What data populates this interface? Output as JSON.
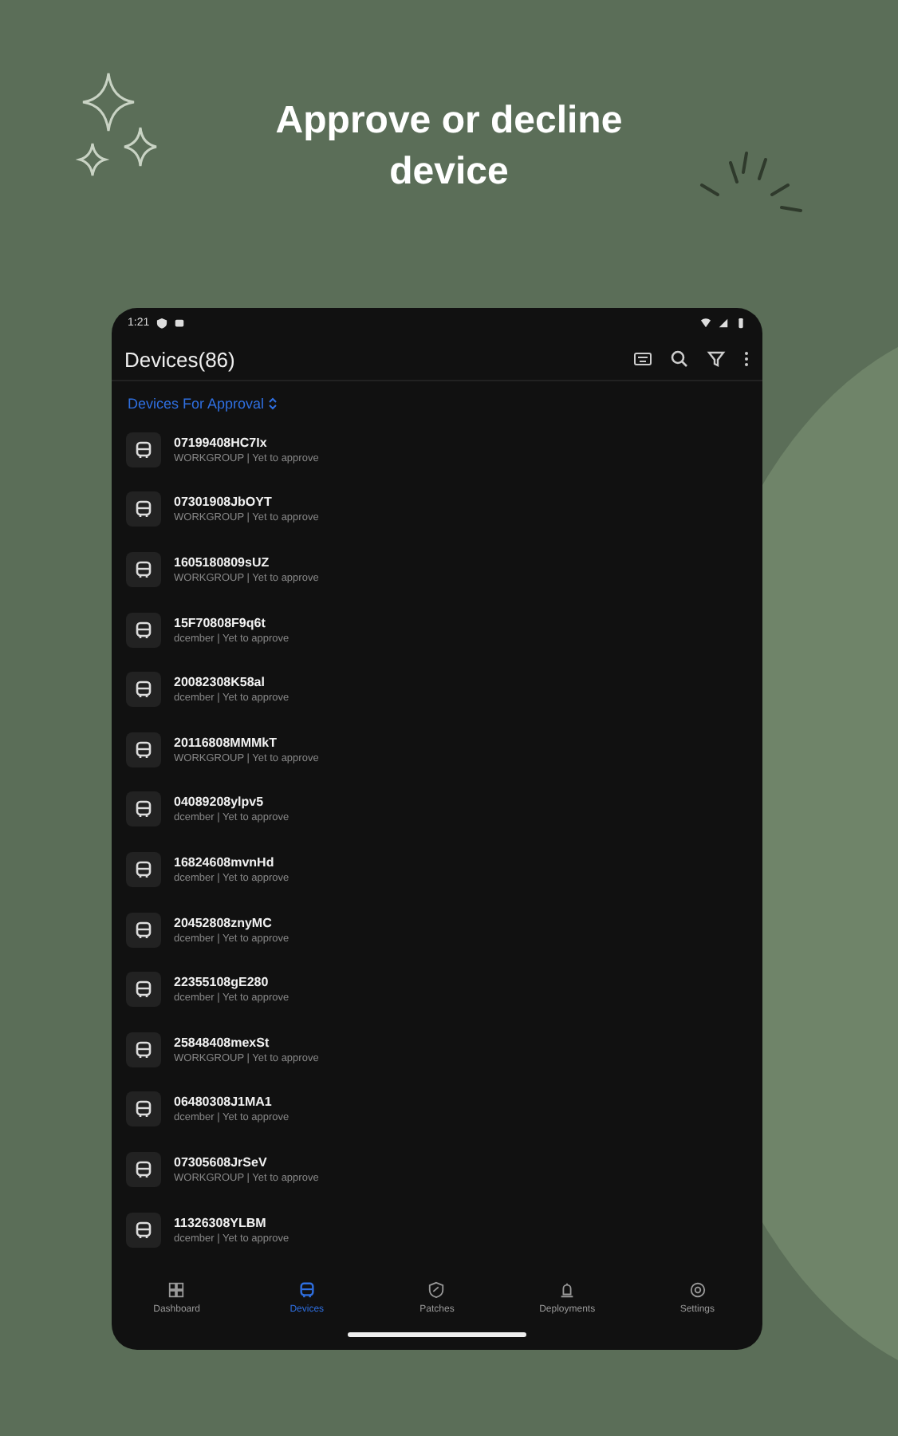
{
  "headline": "Approve or decline device",
  "status_bar": {
    "time": "1:21"
  },
  "app_bar": {
    "title": "Devices(86)"
  },
  "section": {
    "label": "Devices For Approval"
  },
  "devices": [
    {
      "name": "07199408HC7Ix",
      "detail": "WORKGROUP | Yet to approve"
    },
    {
      "name": "07301908JbOYT",
      "detail": "WORKGROUP | Yet to approve"
    },
    {
      "name": "1605180809sUZ",
      "detail": "WORKGROUP | Yet to approve"
    },
    {
      "name": "15F70808F9q6t",
      "detail": "dcember | Yet to approve"
    },
    {
      "name": "20082308K58al",
      "detail": "dcember | Yet to approve"
    },
    {
      "name": "20116808MMMkT",
      "detail": "WORKGROUP | Yet to approve"
    },
    {
      "name": "04089208ylpv5",
      "detail": "dcember | Yet to approve"
    },
    {
      "name": "16824608mvnHd",
      "detail": "dcember | Yet to approve"
    },
    {
      "name": "20452808znyMC",
      "detail": "dcember | Yet to approve"
    },
    {
      "name": "22355108gE280",
      "detail": "dcember | Yet to approve"
    },
    {
      "name": "25848408mexSt",
      "detail": "WORKGROUP | Yet to approve"
    },
    {
      "name": "06480308J1MA1",
      "detail": "dcember | Yet to approve"
    },
    {
      "name": "07305608JrSeV",
      "detail": "WORKGROUP | Yet to approve"
    },
    {
      "name": "11326308YLBM",
      "detail": "dcember | Yet to approve"
    }
  ],
  "nav": [
    {
      "label": "Dashboard",
      "kind": "dashboard",
      "selected": false
    },
    {
      "label": "Devices",
      "kind": "devices",
      "selected": true
    },
    {
      "label": "Patches",
      "kind": "patches",
      "selected": false
    },
    {
      "label": "Deployments",
      "kind": "deployments",
      "selected": false
    },
    {
      "label": "Settings",
      "kind": "settings",
      "selected": false
    }
  ]
}
